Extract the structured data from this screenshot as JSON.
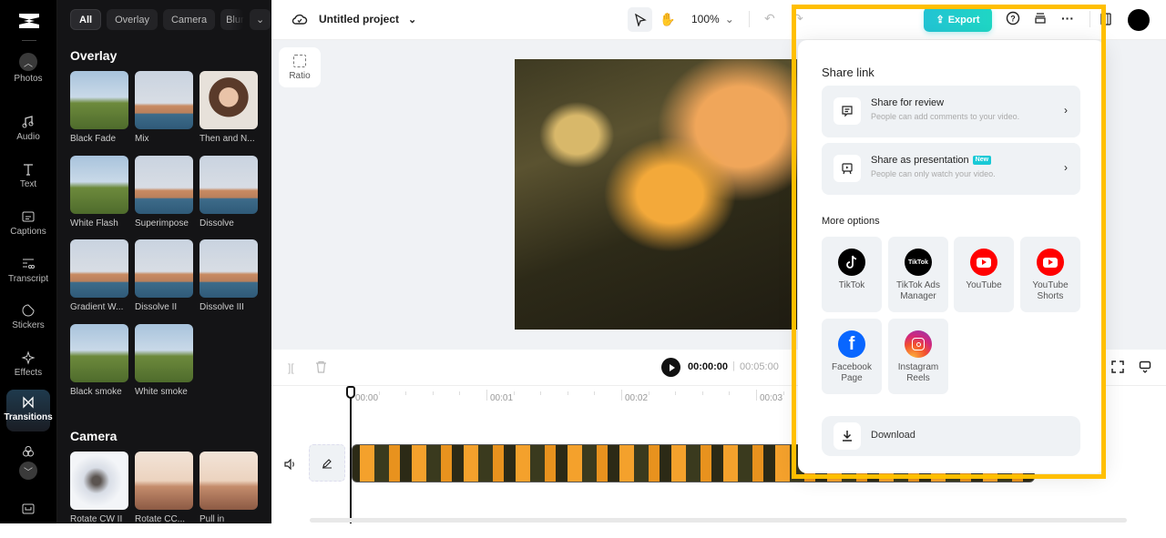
{
  "rail": {
    "items": [
      {
        "label": "Photos",
        "icon": "image-icon"
      },
      {
        "label": "Audio",
        "icon": "music-note-icon"
      },
      {
        "label": "Text",
        "icon": "text-icon"
      },
      {
        "label": "Captions",
        "icon": "captions-icon"
      },
      {
        "label": "Transcript",
        "icon": "transcript-icon"
      },
      {
        "label": "Stickers",
        "icon": "sticker-icon"
      },
      {
        "label": "Effects",
        "icon": "sparkle-icon"
      },
      {
        "label": "Transitions",
        "icon": "transition-icon",
        "active": true
      }
    ]
  },
  "panel": {
    "filters": [
      "All",
      "Overlay",
      "Camera",
      "Blur"
    ],
    "active_filter": "All",
    "sections": [
      {
        "title": "Overlay",
        "items": [
          "Black Fade",
          "Mix",
          "Then and N...",
          "White Flash",
          "Superimpose",
          "Dissolve",
          "Gradient W...",
          "Dissolve II",
          "Dissolve III",
          "Black smoke",
          "White smoke"
        ]
      },
      {
        "title": "Camera",
        "items": [
          "Rotate CW II",
          "Rotate CC...",
          "Pull in"
        ]
      }
    ]
  },
  "topbar": {
    "project_name": "Untitled project",
    "zoom": "100%",
    "export_label": "Export"
  },
  "canvas": {
    "ratio_label": "Ratio"
  },
  "player": {
    "current_time": "00:00:00",
    "total_time": "00:05:00"
  },
  "ruler": {
    "labels": [
      "00:00",
      "00:01",
      "00:02",
      "00:03"
    ]
  },
  "share_popup": {
    "share_link_heading": "Share link",
    "share_options": [
      {
        "title": "Share for review",
        "subtitle": "People can add comments to your video.",
        "badge": ""
      },
      {
        "title": "Share as presentation",
        "subtitle": "People can only watch your video.",
        "badge": "New"
      }
    ],
    "more_options_heading": "More options",
    "platforms": [
      {
        "label": "TikTok",
        "color": "#000000"
      },
      {
        "label": "TikTok Ads\nManager",
        "color": "#000000"
      },
      {
        "label": "YouTube",
        "color": "#ff0000"
      },
      {
        "label": "YouTube\nShorts",
        "color": "#ff0000"
      },
      {
        "label": "Facebook\nPage",
        "color": "#0866ff"
      },
      {
        "label": "Instagram\nReels",
        "color": "#e1306c"
      }
    ],
    "download_label": "Download"
  },
  "colors": {
    "accent": "#1fc8cf",
    "highlight": "#ffbf00"
  }
}
